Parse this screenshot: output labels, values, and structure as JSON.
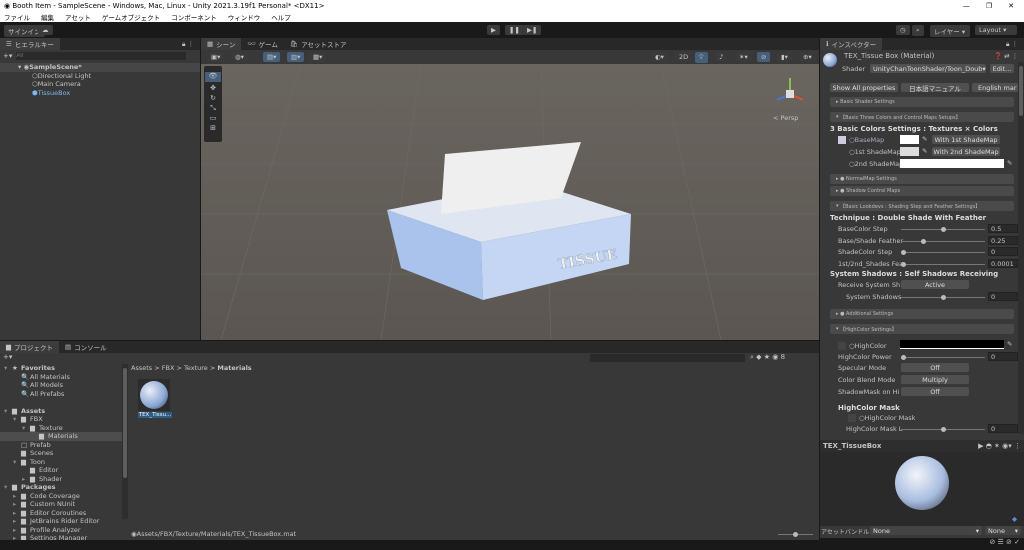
{
  "window": {
    "title": "Booth Item - SampleScene - Windows, Mac, Linux - Unity 2021.3.19f1 Personal* <DX11>",
    "controls": [
      "—",
      "❐",
      "✕"
    ]
  },
  "menu": [
    "ファイル",
    "編集",
    "アセット",
    "ゲームオブジェクト",
    "コンポーネント",
    "ウィンドウ",
    "ヘルプ"
  ],
  "toolbar": {
    "signin": "サインイン",
    "layers": "レイヤー",
    "layout": "Layout"
  },
  "hierarchy": {
    "tab": "ヒエラルキー",
    "search_placeholder": "All",
    "scene": "SampleScene*",
    "items": [
      "Directional Light",
      "Main Camera",
      "TissueBox"
    ]
  },
  "scene": {
    "tabs": [
      "シーン",
      "ゲーム",
      "アセットストア"
    ],
    "mode_2d": "2D",
    "persp": "< Persp",
    "box_label": "TISSUE"
  },
  "inspector": {
    "tab": "インスペクター",
    "title": "TEX_Tissue Box (Material)",
    "shader_label": "Shader",
    "shader_value": "UnityChanToonShader/Toon_Doub",
    "edit": "Edit...",
    "buttons": [
      "Show All properties",
      "日本語マニュアル",
      "English mar"
    ],
    "sections": {
      "basic_shader": "Basic Shader Settings",
      "three_colors": "【Basic Three Colors and Control Maps Setups】",
      "normal": "● NormalMap Settings",
      "shadow_ctrl": "● Shadow Control Maps",
      "lookdevs": "【Basic Lookdevs : Shading Step and Feather Settings】",
      "additional": "● Additional Settings",
      "highcolor": "【HighColor Settings】"
    },
    "colors_header": "3 Basic Colors Settings : Textures × Colors",
    "basemap": "○BaseMap",
    "shade1": "○1st ShadeMap",
    "shade2": "○2nd ShadeMap",
    "with1": "With 1st ShadeMap",
    "with2": "With 2nd ShadeMap",
    "technique": "Technipue : Double Shade With Feather",
    "sliders": [
      {
        "label": "BaseColor Step",
        "value": "0.5",
        "frac": 0.5
      },
      {
        "label": "Base/Shade Feather",
        "value": "0.25",
        "frac": 0.25
      },
      {
        "label": "ShadeColor Step",
        "value": "0",
        "frac": 0
      },
      {
        "label": "1st/2nd_Shades Fea",
        "value": "0.0001",
        "frac": 0
      }
    ],
    "system_shadows": "System Shadows : Self Shadows Receiving",
    "receive_label": "Receive System Sh",
    "receive_value": "Active",
    "sys_shadows_label": "System Shadows",
    "sys_shadows_value": "0",
    "highcolor": "○HighColor",
    "hc_power": "HighColor Power",
    "hc_power_value": "0",
    "specular": "Specular Mode",
    "specular_value": "Off",
    "blend": "Color Blend Mode",
    "blend_value": "Multiply",
    "shadowmask": "ShadowMask on Hi",
    "shadowmask_value": "Off",
    "hc_mask_header": "HighColor Mask",
    "hc_mask": "○HighColor Mask",
    "hc_mask_level": "HighColor Mask L",
    "hc_mask_level_value": "0",
    "preview_title": "TEX_TissueBox",
    "assetbundle_label": "アセットバンドル",
    "assetbundle_value": "None",
    "variant_value": "None"
  },
  "project": {
    "tabs": [
      "プロジェクト",
      "コンソール"
    ],
    "breadcrumb": [
      "Assets",
      "FBX",
      "Texture",
      "Materials"
    ],
    "asset": "TEX_Tissu...",
    "path": "Assets/FBX/Texture/Materials/TEX_TissueBox.mat",
    "icon_count": "8",
    "tree": [
      {
        "label": "Favorites",
        "d": 0,
        "b": true,
        "i": "★"
      },
      {
        "label": "All Materials",
        "d": 1,
        "i": "🔍"
      },
      {
        "label": "All Models",
        "d": 1,
        "i": "🔍"
      },
      {
        "label": "All Prefabs",
        "d": 1,
        "i": "🔍"
      },
      {
        "label": "",
        "d": 0
      },
      {
        "label": "Assets",
        "d": 0,
        "b": true,
        "i": "▆"
      },
      {
        "label": "FBX",
        "d": 1,
        "i": "▆"
      },
      {
        "label": "Texture",
        "d": 2,
        "i": "▆"
      },
      {
        "label": "Materials",
        "d": 3,
        "i": "▆",
        "sel": true
      },
      {
        "label": "Prefab",
        "d": 1,
        "i": "□"
      },
      {
        "label": "Scenes",
        "d": 1,
        "i": "▆"
      },
      {
        "label": "Toon",
        "d": 1,
        "i": "▆"
      },
      {
        "label": "Editor",
        "d": 2,
        "i": "▆"
      },
      {
        "label": "Shader",
        "d": 2,
        "i": "▆"
      },
      {
        "label": "Packages",
        "d": 0,
        "b": true,
        "i": "▆"
      },
      {
        "label": "Code Coverage",
        "d": 1,
        "i": "▆"
      },
      {
        "label": "Custom NUnit",
        "d": 1,
        "i": "▆"
      },
      {
        "label": "Editor Coroutines",
        "d": 1,
        "i": "▆"
      },
      {
        "label": "JetBrains Rider Editor",
        "d": 1,
        "i": "▆"
      },
      {
        "label": "Profile Analyzer",
        "d": 1,
        "i": "▆"
      },
      {
        "label": "Settings Manager",
        "d": 1,
        "i": "▆"
      }
    ]
  }
}
